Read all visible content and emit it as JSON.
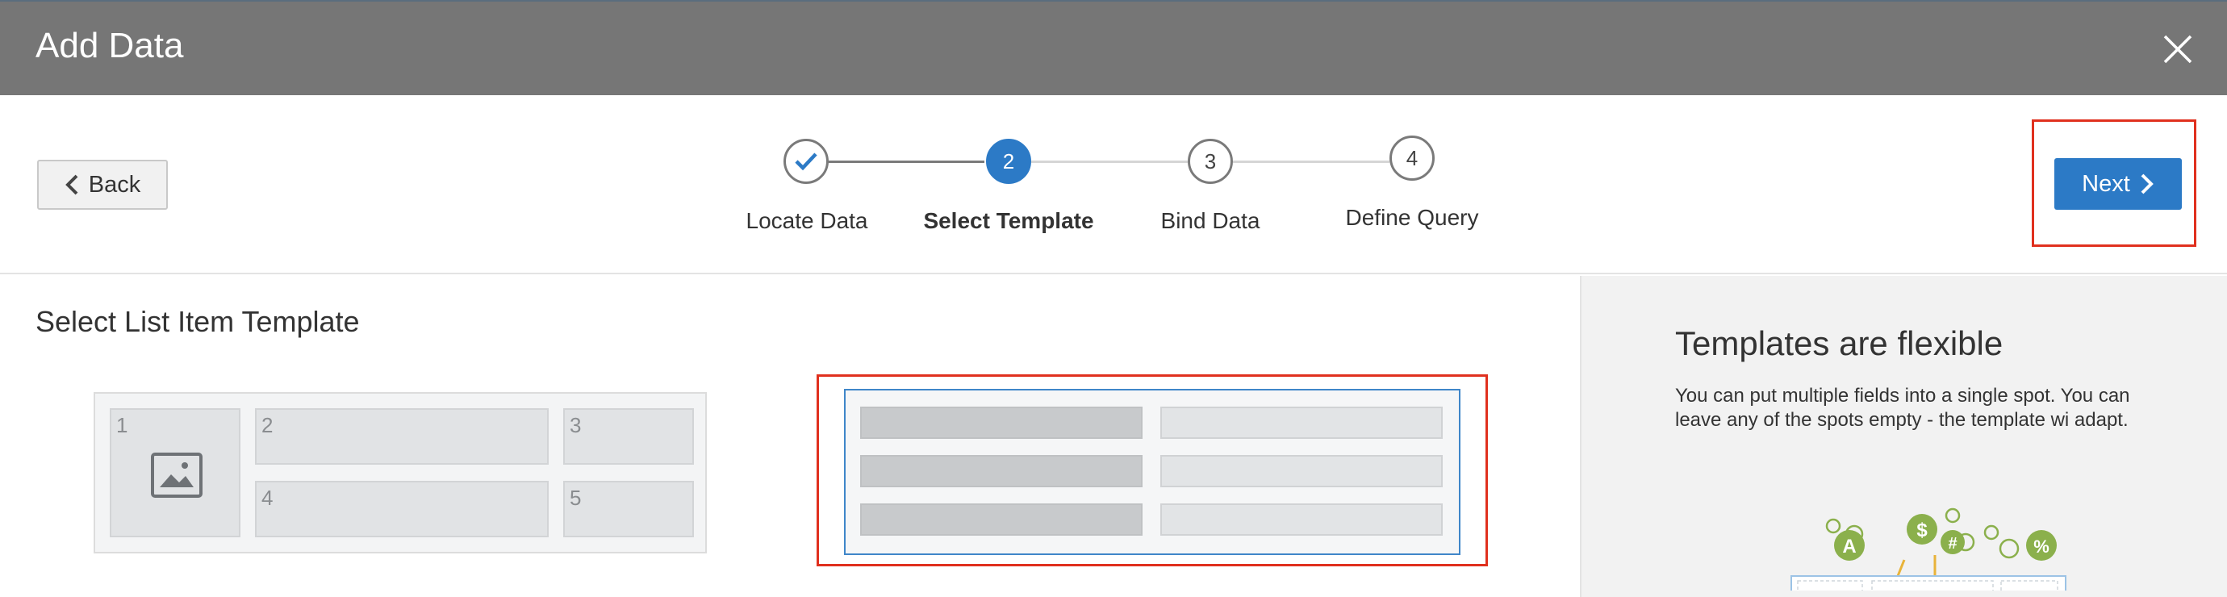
{
  "dialog": {
    "title": "Add Data"
  },
  "toolbar": {
    "back_label": "Back",
    "next_label": "Next"
  },
  "steps": [
    {
      "number": "",
      "label": "Locate Data",
      "state": "complete"
    },
    {
      "number": "2",
      "label": "Select Template",
      "state": "active"
    },
    {
      "number": "3",
      "label": "Bind Data",
      "state": "pending"
    },
    {
      "number": "4",
      "label": "Define Query",
      "state": "pending"
    }
  ],
  "main": {
    "heading": "Select List Item Template",
    "template_cells": [
      "1",
      "2",
      "3",
      "4",
      "5"
    ]
  },
  "side": {
    "title": "Templates are flexible",
    "body": "You can put multiple fields into a single spot. You can leave any of the spots empty - the template wi adapt."
  },
  "illustration_glyphs": [
    "$",
    "#",
    "%",
    "A"
  ],
  "colors": {
    "accent": "#2c7ac6",
    "highlight": "#e0301e",
    "titlebar": "#767676",
    "illustration": "#8bb04c"
  }
}
